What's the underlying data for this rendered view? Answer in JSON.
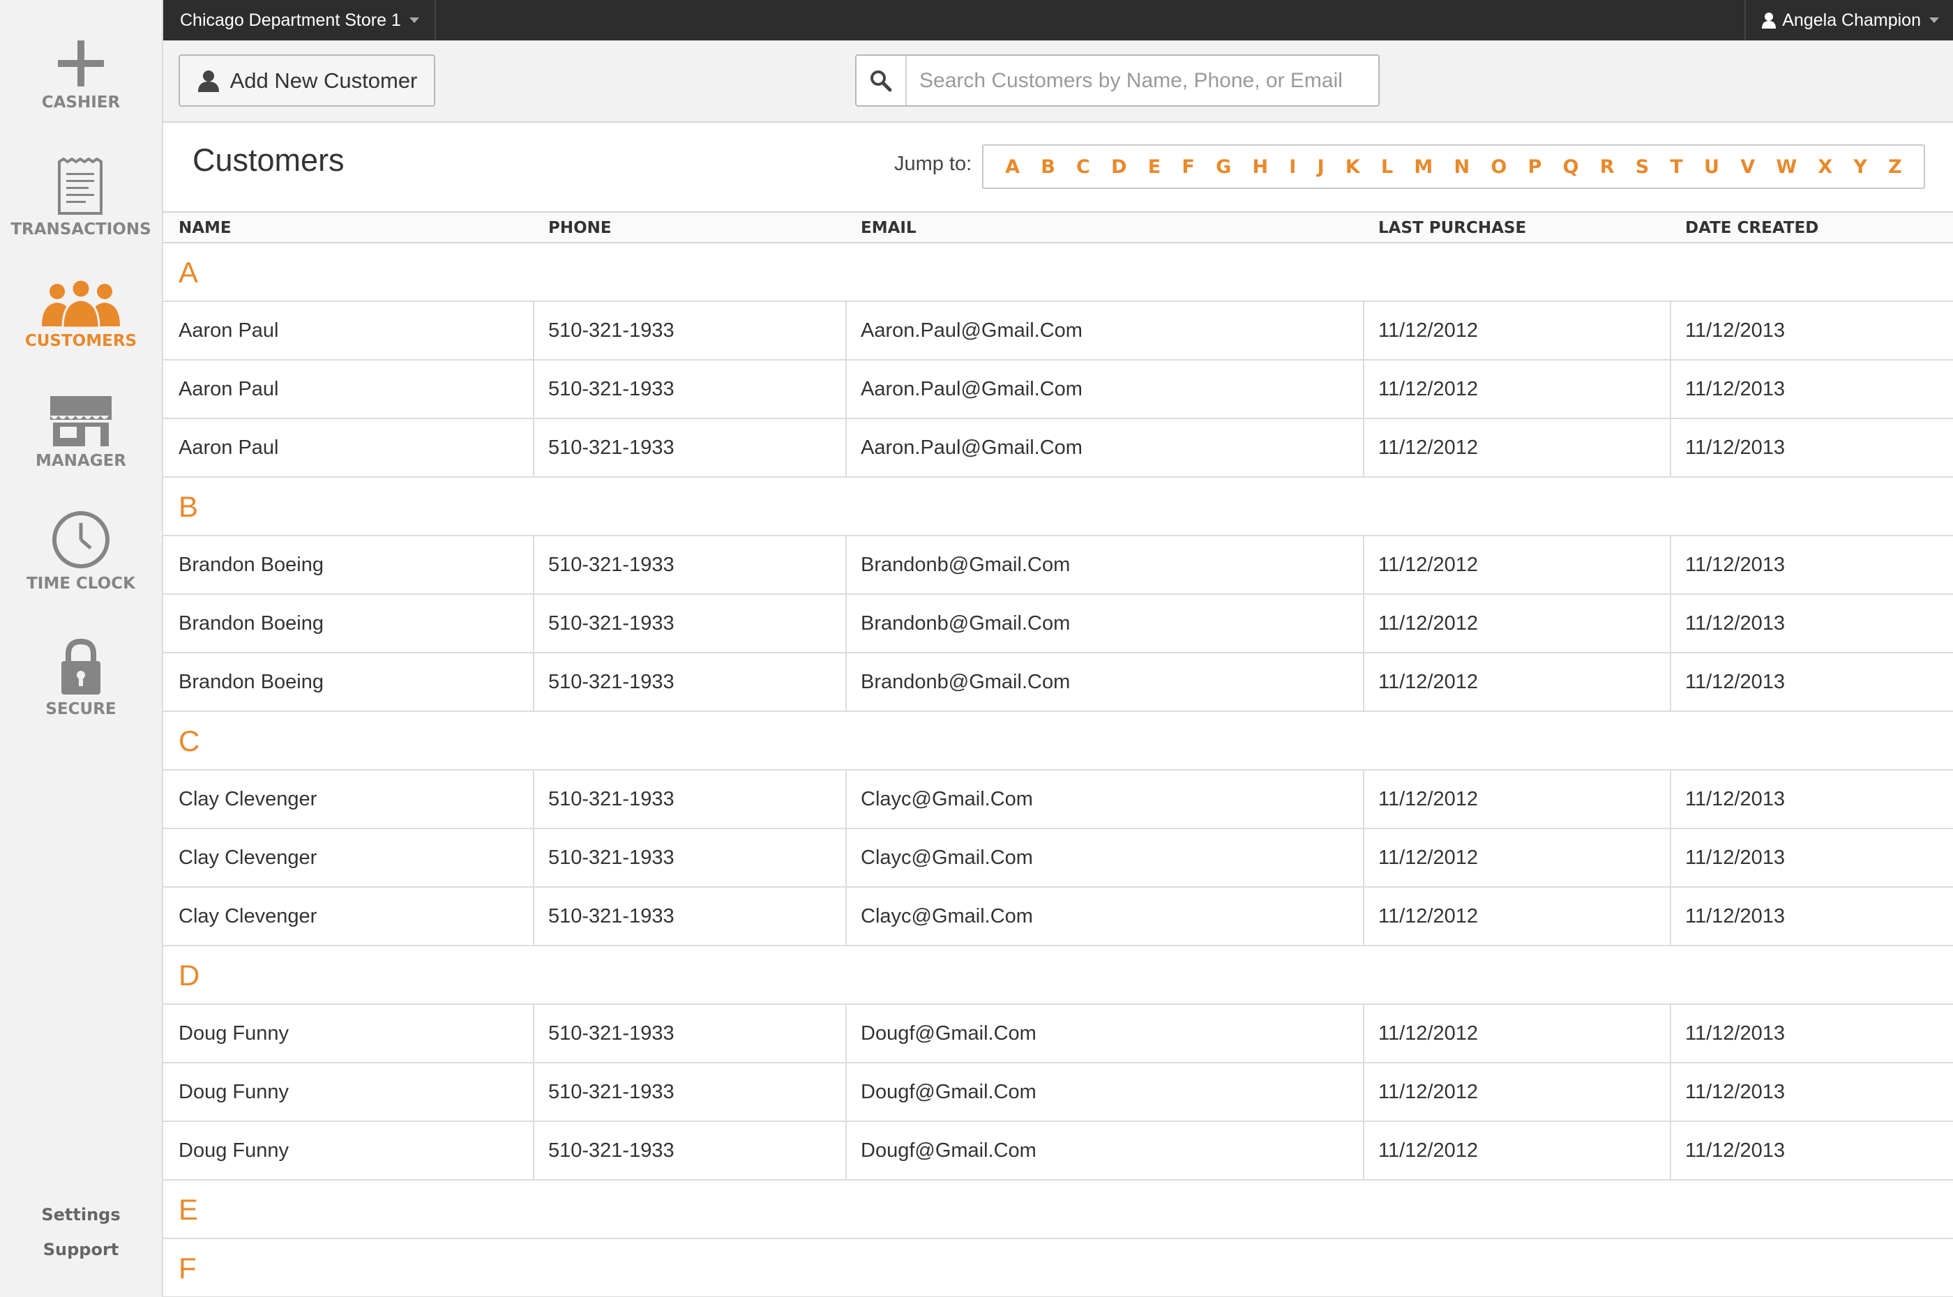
{
  "sidebar": {
    "items": [
      {
        "label": "CASHIER",
        "icon": "plus-icon"
      },
      {
        "label": "TRANSACTIONS",
        "icon": "receipt-icon"
      },
      {
        "label": "CUSTOMERS",
        "icon": "users-icon"
      },
      {
        "label": "MANAGER",
        "icon": "storefront-icon"
      },
      {
        "label": "TIME CLOCK",
        "icon": "clock-icon"
      },
      {
        "label": "SECURE",
        "icon": "lock-icon"
      }
    ],
    "active": "CUSTOMERS",
    "links": [
      "Settings",
      "Support"
    ]
  },
  "topbar": {
    "store": "Chicago Department Store 1",
    "user": "Angela Champion"
  },
  "toolbar": {
    "add_label": "Add New Customer",
    "search_placeholder": "Search Customers by Name, Phone, or Email"
  },
  "page": {
    "title": "Customers",
    "jump_label": "Jump to:",
    "letters": [
      "A",
      "B",
      "C",
      "D",
      "E",
      "F",
      "G",
      "H",
      "I",
      "J",
      "K",
      "L",
      "M",
      "N",
      "O",
      "P",
      "Q",
      "R",
      "S",
      "T",
      "U",
      "V",
      "W",
      "X",
      "Y",
      "Z"
    ]
  },
  "table": {
    "columns": [
      "NAME",
      "PHONE",
      "EMAIL",
      "LAST PURCHASE",
      "DATE CREATED"
    ],
    "groups": [
      {
        "letter": "A",
        "rows": [
          [
            "Aaron Paul",
            "510-321-1933",
            "Aaron.Paul@Gmail.Com",
            "11/12/2012",
            "11/12/2013"
          ],
          [
            "Aaron Paul",
            "510-321-1933",
            "Aaron.Paul@Gmail.Com",
            "11/12/2012",
            "11/12/2013"
          ],
          [
            "Aaron Paul",
            "510-321-1933",
            "Aaron.Paul@Gmail.Com",
            "11/12/2012",
            "11/12/2013"
          ]
        ]
      },
      {
        "letter": "B",
        "rows": [
          [
            "Brandon Boeing",
            "510-321-1933",
            "Brandonb@Gmail.Com",
            "11/12/2012",
            "11/12/2013"
          ],
          [
            "Brandon Boeing",
            "510-321-1933",
            "Brandonb@Gmail.Com",
            "11/12/2012",
            "11/12/2013"
          ],
          [
            "Brandon Boeing",
            "510-321-1933",
            "Brandonb@Gmail.Com",
            "11/12/2012",
            "11/12/2013"
          ]
        ]
      },
      {
        "letter": "C",
        "rows": [
          [
            "Clay Clevenger",
            "510-321-1933",
            "Clayc@Gmail.Com",
            "11/12/2012",
            "11/12/2013"
          ],
          [
            "Clay Clevenger",
            "510-321-1933",
            "Clayc@Gmail.Com",
            "11/12/2012",
            "11/12/2013"
          ],
          [
            "Clay Clevenger",
            "510-321-1933",
            "Clayc@Gmail.Com",
            "11/12/2012",
            "11/12/2013"
          ]
        ]
      },
      {
        "letter": "D",
        "rows": [
          [
            "Doug Funny",
            "510-321-1933",
            "Dougf@Gmail.Com",
            "11/12/2012",
            "11/12/2013"
          ],
          [
            "Doug Funny",
            "510-321-1933",
            "Dougf@Gmail.Com",
            "11/12/2012",
            "11/12/2013"
          ],
          [
            "Doug Funny",
            "510-321-1933",
            "Dougf@Gmail.Com",
            "11/12/2012",
            "11/12/2013"
          ]
        ]
      },
      {
        "letter": "E",
        "rows": []
      },
      {
        "letter": "F",
        "rows": []
      }
    ]
  },
  "colors": {
    "accent": "#e8892b",
    "topbar": "#2d2d2d",
    "sidebar": "#f2f2f2"
  }
}
